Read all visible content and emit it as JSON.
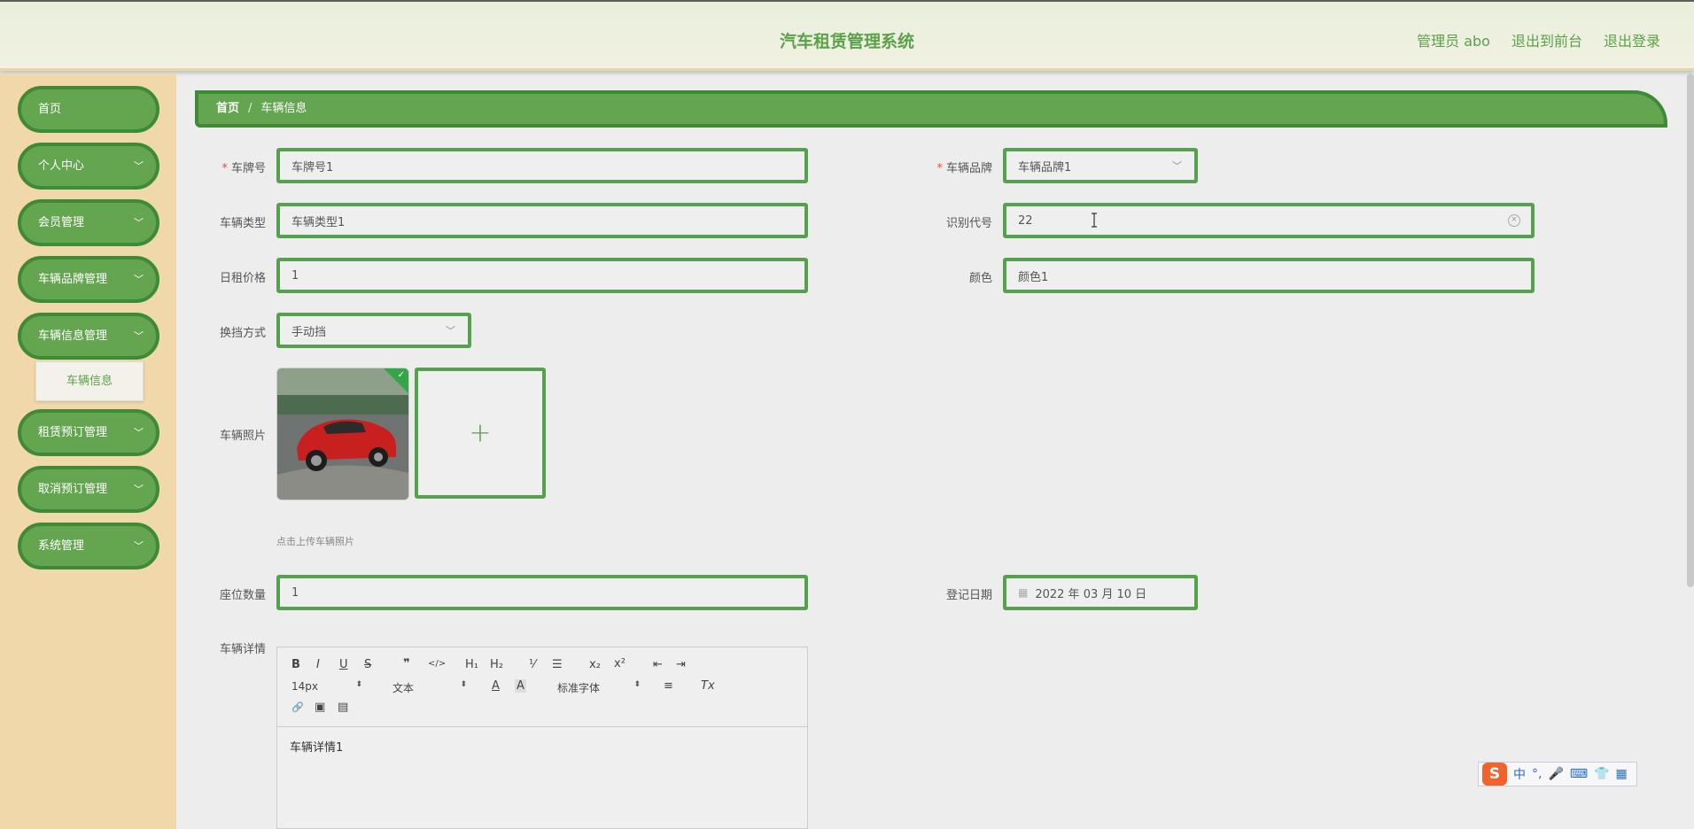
{
  "app": {
    "title": "汽车租赁管理系统"
  },
  "top_links": {
    "admin": "管理员 abo",
    "front": "退出到前台",
    "logout": "退出登录"
  },
  "sidebar": {
    "items": [
      {
        "label": "首页"
      },
      {
        "label": "个人中心"
      },
      {
        "label": "会员管理"
      },
      {
        "label": "车辆品牌管理"
      },
      {
        "label": "车辆信息管理"
      },
      {
        "label": "租赁预订管理"
      },
      {
        "label": "取消预订管理"
      },
      {
        "label": "系统管理"
      }
    ],
    "submenu": {
      "label": "车辆信息"
    }
  },
  "breadcrumb": {
    "home": "首页",
    "separator": "/",
    "current": "车辆信息"
  },
  "form": {
    "plate": {
      "label": "车牌号",
      "value": "车牌号1",
      "required": "*"
    },
    "brand": {
      "label": "车辆品牌",
      "value": "车辆品牌1",
      "required": "*"
    },
    "type": {
      "label": "车辆类型",
      "value": "车辆类型1"
    },
    "vin": {
      "label": "识别代号",
      "value": "22"
    },
    "price": {
      "label": "日租价格",
      "value": "1"
    },
    "color": {
      "label": "颜色",
      "value": "颜色1"
    },
    "gear": {
      "label": "换挡方式",
      "value": "手动挡"
    },
    "photo": {
      "label": "车辆照片",
      "hint": "点击上传车辆照片",
      "plus": "+"
    },
    "seats": {
      "label": "座位数量",
      "value": "1"
    },
    "regdate": {
      "label": "登记日期",
      "value": "2022 年 03 月 10 日"
    },
    "detail": {
      "label": "车辆详情",
      "value": "车辆详情1"
    }
  },
  "editor_toolbar": {
    "bold": "B",
    "italic": "I",
    "underline": "U",
    "strike": "S",
    "quote": "❞",
    "code": "</>",
    "h1": "H₁",
    "h2": "H₂",
    "ol": "⅟",
    "ul": "☰",
    "sub": "x₂",
    "sup": "x²",
    "outdent": "⇤",
    "indent": "⇥",
    "size": "14px",
    "format": "文本",
    "font": "标准字体",
    "color": "A",
    "bg": "A",
    "align": "≡",
    "clear": "Tx",
    "link": "🔗",
    "image": "▣",
    "video": "▤"
  },
  "ime": {
    "logo": "S",
    "mode": "中",
    "punct": "°,",
    "mic": "🎤",
    "kbd": "⌨",
    "skin": "👕",
    "more": "▦"
  },
  "colors": {
    "accent": "#5aa14a",
    "border": "#3f8a36",
    "sidebar": "#f0d8ab"
  }
}
